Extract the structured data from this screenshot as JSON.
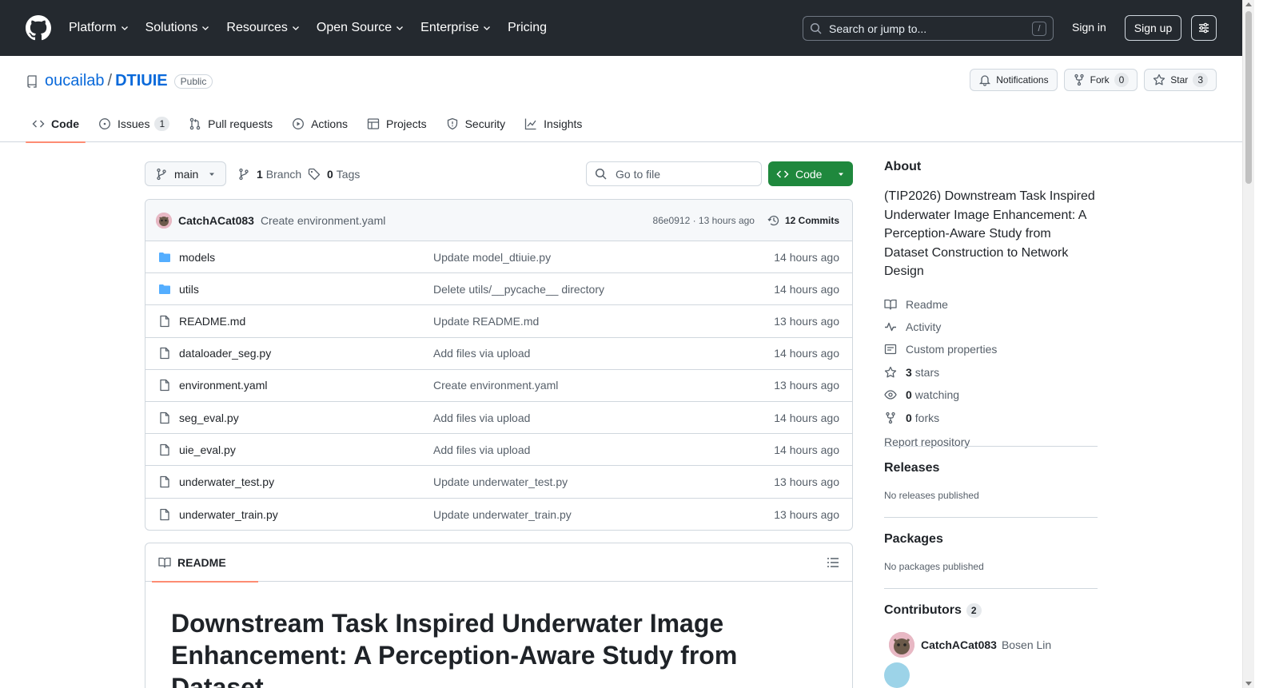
{
  "top_nav": {
    "items": [
      "Platform",
      "Solutions",
      "Resources",
      "Open Source",
      "Enterprise",
      "Pricing"
    ],
    "search_placeholder": "Search or jump to...",
    "search_key": "/",
    "sign_in": "Sign in",
    "sign_up": "Sign up"
  },
  "repo": {
    "owner": "oucailab",
    "separator": "/",
    "name": "DTIUIE",
    "visibility": "Public",
    "notifications_label": "Notifications",
    "fork_label": "Fork",
    "fork_count": "0",
    "star_label": "Star",
    "star_count": "3"
  },
  "tabs": [
    {
      "label": "Code",
      "count": ""
    },
    {
      "label": "Issues",
      "count": "1"
    },
    {
      "label": "Pull requests",
      "count": ""
    },
    {
      "label": "Actions",
      "count": ""
    },
    {
      "label": "Projects",
      "count": ""
    },
    {
      "label": "Security",
      "count": ""
    },
    {
      "label": "Insights",
      "count": ""
    }
  ],
  "toolbar": {
    "branch": "main",
    "branch_count": "1",
    "branch_label": "Branch",
    "tag_count": "0",
    "tag_label": "Tags",
    "goto_placeholder": "Go to file",
    "code_button": "Code"
  },
  "latest_commit": {
    "author": "CatchACat083",
    "message": "Create environment.yaml",
    "meta": "86e0912 · 13 hours ago",
    "commits": "12 Commits"
  },
  "files": [
    {
      "type": "folder",
      "name": "models",
      "message": "Update model_dtiuie.py",
      "time": "14 hours ago"
    },
    {
      "type": "folder",
      "name": "utils",
      "message": "Delete utils/__pycache__ directory",
      "time": "14 hours ago"
    },
    {
      "type": "file",
      "name": "README.md",
      "message": "Update README.md",
      "time": "13 hours ago"
    },
    {
      "type": "file",
      "name": "dataloader_seg.py",
      "message": "Add files via upload",
      "time": "14 hours ago"
    },
    {
      "type": "file",
      "name": "environment.yaml",
      "message": "Create environment.yaml",
      "time": "13 hours ago"
    },
    {
      "type": "file",
      "name": "seg_eval.py",
      "message": "Add files via upload",
      "time": "14 hours ago"
    },
    {
      "type": "file",
      "name": "uie_eval.py",
      "message": "Add files via upload",
      "time": "14 hours ago"
    },
    {
      "type": "file",
      "name": "underwater_test.py",
      "message": "Update underwater_test.py",
      "time": "13 hours ago"
    },
    {
      "type": "file",
      "name": "underwater_train.py",
      "message": "Update underwater_train.py",
      "time": "13 hours ago"
    }
  ],
  "readme": {
    "tab_label": "README",
    "heading": "Downstream Task Inspired Underwater Image Enhancement: A Perception-Aware Study from Dataset"
  },
  "about": {
    "title": "About",
    "description": "(TIP2026) Downstream Task Inspired Underwater Image Enhancement: A Perception-Aware Study from Dataset Construction to Network Design",
    "readme": "Readme",
    "activity": "Activity",
    "custom_properties": "Custom properties",
    "stars_count": "3",
    "stars_label": "stars",
    "watching_count": "0",
    "watching_label": "watching",
    "forks_count": "0",
    "forks_label": "forks",
    "report": "Report repository"
  },
  "releases": {
    "title": "Releases",
    "text": "No releases published"
  },
  "packages": {
    "title": "Packages",
    "text": "No packages published"
  },
  "contributors": {
    "title": "Contributors",
    "count": "2",
    "first_login": "CatchACat083",
    "first_name": "Bosen Lin"
  }
}
